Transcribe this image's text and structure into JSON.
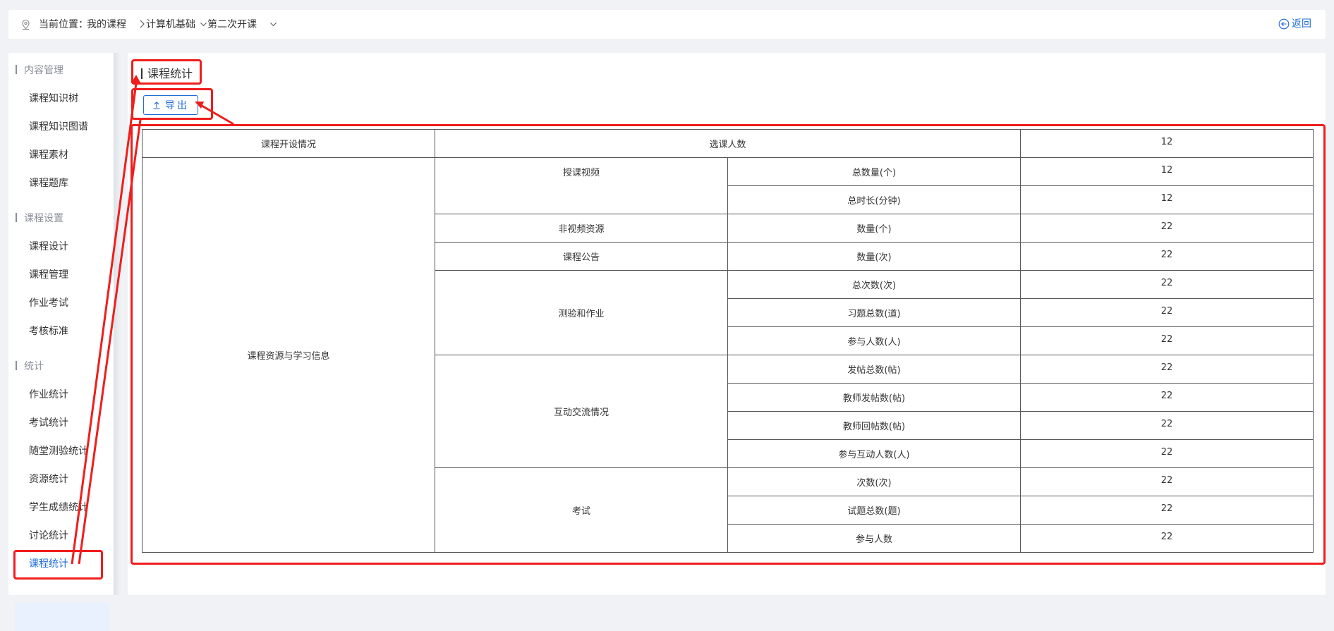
{
  "header": {
    "location_label": "当前位置：",
    "crumbs": [
      "我的课程",
      "计算机基础",
      "第二次开课"
    ],
    "back_label": "返回"
  },
  "sidebar": {
    "sections": [
      {
        "title": "内容管理",
        "items": [
          "课程知识树",
          "课程知识图谱",
          "课程素材",
          "课程题库"
        ]
      },
      {
        "title": "课程设置",
        "items": [
          "课程设计",
          "课程管理",
          "作业考试",
          "考核标准"
        ]
      },
      {
        "title": "统计",
        "items": [
          "作业统计",
          "考试统计",
          "随堂测验统计",
          "资源统计",
          "学生成绩统计",
          "讨论统计",
          "课程统计"
        ]
      }
    ],
    "active_item": "课程统计"
  },
  "main": {
    "title": "课程统计",
    "export_label": "导出"
  },
  "table": {
    "overview": {
      "label": "课程开设情况",
      "metric": "选课人数",
      "value": "12"
    },
    "group_label": "课程资源与学习信息",
    "categories": [
      {
        "name": "授课视频",
        "rows": [
          {
            "metric": "总数量(个)",
            "value": "12"
          },
          {
            "metric": "总时长(分钟)",
            "value": "12"
          }
        ]
      },
      {
        "name": "非视频资源",
        "rows": [
          {
            "metric": "数量(个)",
            "value": "22"
          }
        ]
      },
      {
        "name": "课程公告",
        "rows": [
          {
            "metric": "数量(次)",
            "value": "22"
          }
        ]
      },
      {
        "name": "测验和作业",
        "rows": [
          {
            "metric": "总次数(次)",
            "value": "22"
          },
          {
            "metric": "习题总数(道)",
            "value": "22"
          },
          {
            "metric": "参与人数(人)",
            "value": "22"
          }
        ]
      },
      {
        "name": "互动交流情况",
        "rows": [
          {
            "metric": "发帖总数(帖)",
            "value": "22"
          },
          {
            "metric": "教师发帖数(帖)",
            "value": "22"
          },
          {
            "metric": "教师回帖数(帖)",
            "value": "22"
          },
          {
            "metric": "参与互动人数(人)",
            "value": "22"
          }
        ]
      },
      {
        "name": "考试",
        "rows": [
          {
            "metric": "次数(次)",
            "value": "22"
          },
          {
            "metric": "试题总数(题)",
            "value": "22"
          },
          {
            "metric": "参与人数",
            "value": "22"
          }
        ]
      }
    ]
  },
  "colors": {
    "accent": "#1e6bd6",
    "annotation": "#f01d1d",
    "active_bg": "#e8f1fd"
  }
}
